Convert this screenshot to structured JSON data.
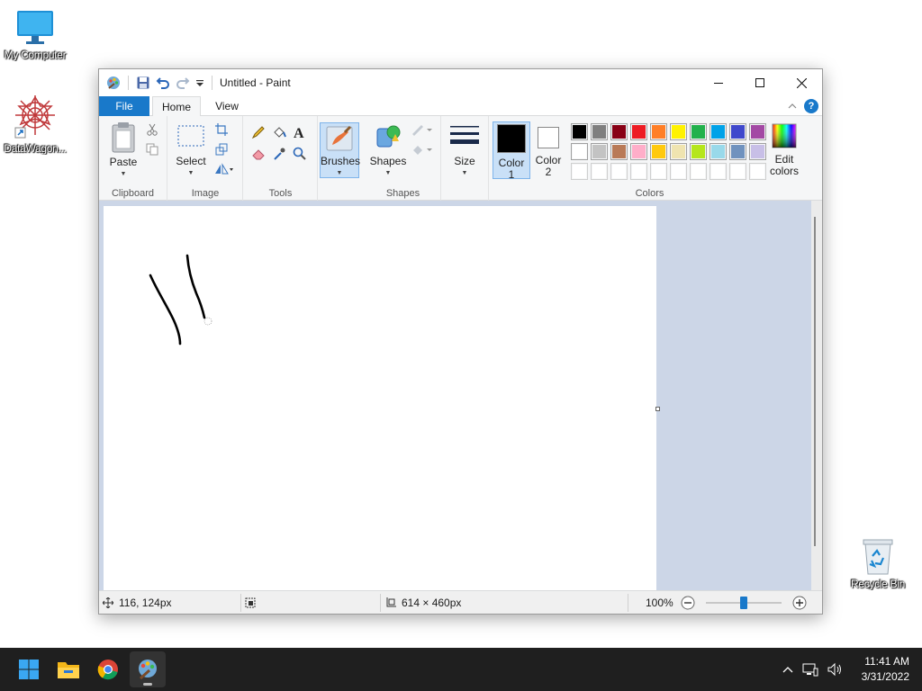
{
  "desktop": {
    "icons": [
      {
        "label": "My Computer"
      },
      {
        "label": "DataWagon..."
      },
      {
        "label": "Recycle Bin"
      }
    ]
  },
  "window": {
    "title": "Untitled - Paint",
    "tabs": {
      "file": "File",
      "home": "Home",
      "view": "View"
    },
    "help": "?"
  },
  "ribbon": {
    "clipboard": {
      "title": "Clipboard",
      "paste": "Paste"
    },
    "image": {
      "title": "Image",
      "select": "Select"
    },
    "tools": {
      "title": "Tools"
    },
    "brushes": {
      "label": "Brushes"
    },
    "shapes": {
      "title": "Shapes",
      "label": "Shapes"
    },
    "size": {
      "label": "Size"
    },
    "colors": {
      "title": "Colors",
      "color1": "Color\n1",
      "color1_a": "Color",
      "color1_b": "1",
      "color2_a": "Color",
      "color2_b": "2",
      "edit_a": "Edit",
      "edit_b": "colors",
      "color1_value": "#000000",
      "color2_value": "#ffffff",
      "palette_row1": [
        "#000000",
        "#7f7f7f",
        "#880015",
        "#ed1c24",
        "#ff7f27",
        "#fff200",
        "#22b14c",
        "#00a2e8",
        "#3f48cc",
        "#a349a4"
      ],
      "palette_row2": [
        "#ffffff",
        "#c3c3c3",
        "#b97a57",
        "#ffaec9",
        "#ffc90e",
        "#efe4b0",
        "#b5e61d",
        "#99d9ea",
        "#7092be",
        "#c8bfe7"
      ],
      "palette_row3": [
        "#ffffff",
        "#ffffff",
        "#ffffff",
        "#ffffff",
        "#ffffff",
        "#ffffff",
        "#ffffff",
        "#ffffff",
        "#ffffff",
        "#ffffff"
      ]
    }
  },
  "status": {
    "cursor_pos": "116, 124px",
    "canvas_size": "614 × 460px",
    "zoom": "100%",
    "zoom_fraction": 0.5
  },
  "taskbar": {
    "time": "11:41 AM",
    "date": "3/31/2022"
  }
}
